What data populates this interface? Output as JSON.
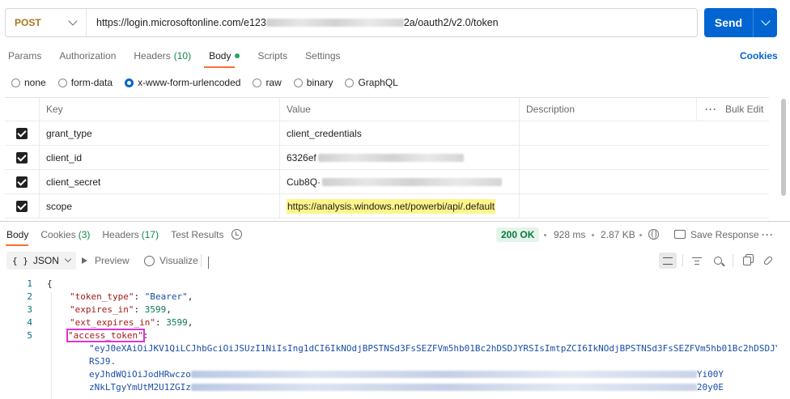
{
  "request": {
    "method": "POST",
    "url_start": "https://login.microsoftonline.com/e123",
    "url_end": "2a/oauth2/v2.0/token",
    "send_label": "Send"
  },
  "request_tabs": {
    "params": "Params",
    "authorization": "Authorization",
    "headers": "Headers",
    "headers_count": "(10)",
    "body": "Body",
    "scripts": "Scripts",
    "settings": "Settings",
    "cookies": "Cookies"
  },
  "body_types": {
    "none": "none",
    "form_data": "form-data",
    "urlencoded": "x-www-form-urlencoded",
    "raw": "raw",
    "binary": "binary",
    "graphql": "GraphQL"
  },
  "table": {
    "col_key": "Key",
    "col_value": "Value",
    "col_description": "Description",
    "bulk_edit": "Bulk Edit",
    "rows": [
      {
        "key": "grant_type",
        "value": "client_credentials"
      },
      {
        "key": "client_id",
        "value": "6326ef"
      },
      {
        "key": "client_secret",
        "value": "Cub8Q·"
      },
      {
        "key": "scope",
        "value": "https://analysis.windows.net/powerbi/api/.default"
      }
    ]
  },
  "response": {
    "tabs": {
      "body": "Body",
      "cookies": "Cookies",
      "cookies_count": "(3)",
      "headers": "Headers",
      "headers_count": "(17)",
      "test_results": "Test Results"
    },
    "status": "200 OK",
    "time": "928 ms",
    "size": "2.87 KB",
    "save_response": "Save Response",
    "format": "JSON",
    "preview": "Preview",
    "visualize": "Visualize"
  },
  "code": {
    "line_numbers": [
      "1",
      "2",
      "3",
      "4",
      "5"
    ],
    "open_brace": "{",
    "token_type_key": "\"token_type\"",
    "token_type_value": "\"Bearer\"",
    "expires_in_key": "\"expires_in\"",
    "expires_in_value": "3599",
    "ext_expires_in_key": "\"ext_expires_in\"",
    "ext_expires_in_value": "3599",
    "access_token_key": "\"access_token\"",
    "token_line_1": "\"eyJ0eXAiOiJKV1QiLCJhbGciOiJSUzI1NiIsIng1dCI6IkNOdjBPSTNSd3FsSEZFVm5hb01Bc2hDSDJYRSIsImtpZCI6IkNOdjBPSTNSd3FsSEZFVm5hb01Bc2hDSDJY",
    "token_line_2": "RSJ9.",
    "token_line_3_start": "eyJhdWQiOiJodHRwczo",
    "token_line_3_end": "Yi00Y",
    "token_line_4_start": "zNkLTgyYmUtM2U1ZGIz",
    "token_line_4_end": "20y0E"
  },
  "colors": {
    "send": "#0265d2",
    "method": "#a7781c",
    "status_green": "#0b7a3f",
    "highlight": "#fdf58a",
    "access_token_outline": "#e032d8"
  }
}
